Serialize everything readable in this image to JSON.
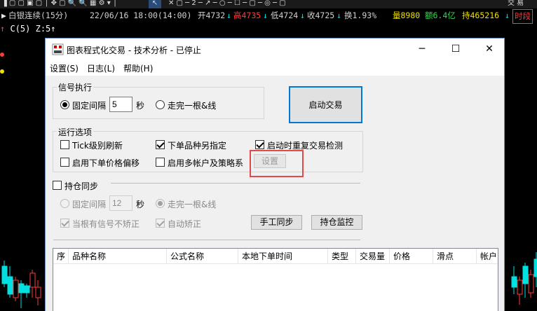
{
  "ticker": {
    "name": "白银连续(15分)",
    "datetime": "22/06/16 18:00(14:00)",
    "open": "开4732",
    "high": "高4735",
    "low": "低4724",
    "close": "收4725",
    "turnover": "换1.93%",
    "volume": "量8980",
    "amount": "额6.4亿",
    "position": "持465216",
    "segment": "时段"
  },
  "indicator": {
    "c_label": "C(5)",
    "z_label": "Z:5"
  },
  "toolbar": {
    "right_label": "交 易"
  },
  "dialog": {
    "title": "图表程式化交易 - 技术分析 - 已停止",
    "menu": [
      "设置(S)",
      "日志(L)",
      "帮助(H)"
    ],
    "signal_group": {
      "title": "信号执行",
      "fixed_interval_label": "固定间隔",
      "interval_value": "5",
      "seconds_label": "秒",
      "bar_complete_label": "走完一根&线",
      "selected": "fixed"
    },
    "start_button": "启动交易",
    "run_group": {
      "title": "运行选项",
      "options": [
        {
          "label": "Tick级别刷新",
          "checked": false
        },
        {
          "label": "下单品种另指定",
          "checked": true
        },
        {
          "label": "启动时重复交易检测",
          "checked": true
        },
        {
          "label": "启用下单价格偏移",
          "checked": false
        },
        {
          "label": "启用多帐户及策略系",
          "checked": false
        }
      ],
      "settings_button": "设置"
    },
    "sync": {
      "title": "持仓同步",
      "checked": false,
      "fixed_interval_label": "固定间隔",
      "interval_value": "12",
      "seconds_label": "秒",
      "bar_complete_label": "走完一根&线",
      "no_correct_label": "当根有信号不矫正",
      "no_correct_checked": true,
      "auto_correct_label": "自动矫正",
      "auto_correct_checked": true,
      "manual_sync_button": "手工同步",
      "monitor_button": "持仓监控"
    },
    "table": {
      "columns": [
        "序",
        "品种名称",
        "公式名称",
        "本地下单时间",
        "类型",
        "交易量",
        "价格",
        "滑点",
        "帐户"
      ]
    }
  },
  "colors": {
    "up": "#ff3b3b",
    "down": "#00e0e0",
    "accent": "#0078d7",
    "highlight": "#e24a4a"
  }
}
